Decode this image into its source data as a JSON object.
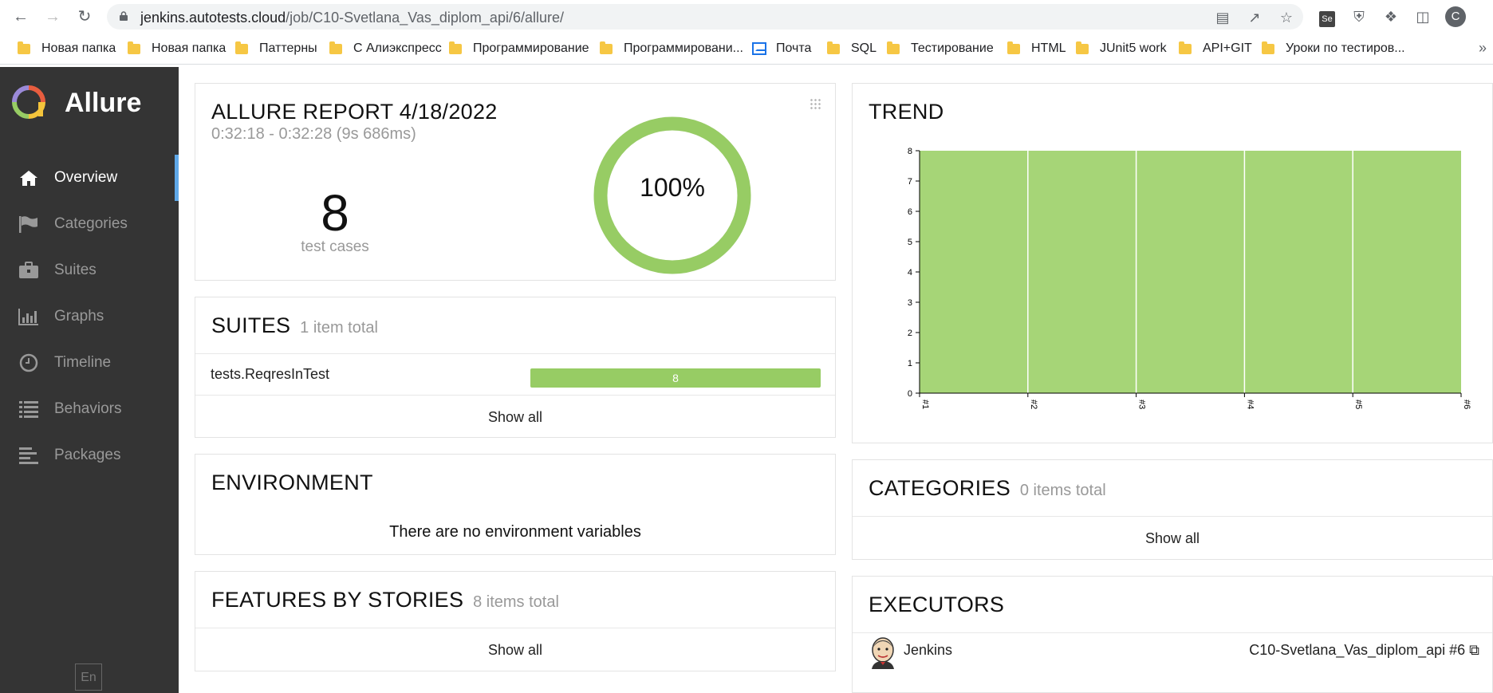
{
  "browser": {
    "url_host": "jenkins.autotests.cloud",
    "url_path": "/job/C10-Svetlana_Vas_diplom_api/6/allure/",
    "profile_initial": "C",
    "bookmarks": [
      {
        "label": "Новая папка",
        "icon": "folder-icon"
      },
      {
        "label": "Новая папка",
        "icon": "folder-icon"
      },
      {
        "label": "Паттерны",
        "icon": "folder-icon"
      },
      {
        "label": "С Алиэкспресс",
        "icon": "folder-icon"
      },
      {
        "label": "Программирование",
        "icon": "folder-icon"
      },
      {
        "label": "Программировани...",
        "icon": "folder-icon"
      },
      {
        "label": "Почта",
        "icon": "mail-icon"
      },
      {
        "label": "SQL",
        "icon": "folder-icon"
      },
      {
        "label": "Тестирование",
        "icon": "folder-icon"
      },
      {
        "label": "HTML",
        "icon": "folder-icon"
      },
      {
        "label": "JUnit5 work",
        "icon": "folder-icon"
      },
      {
        "label": "API+GIT",
        "icon": "folder-icon"
      },
      {
        "label": "Уроки по тестиров...",
        "icon": "folder-icon"
      }
    ],
    "more": "»"
  },
  "sidebar": {
    "brand": "Allure",
    "items": [
      {
        "label": "Overview",
        "icon": "home-icon",
        "active": true
      },
      {
        "label": "Categories",
        "icon": "flag-icon",
        "active": false
      },
      {
        "label": "Suites",
        "icon": "briefcase-icon",
        "active": false
      },
      {
        "label": "Graphs",
        "icon": "bar-chart-icon",
        "active": false
      },
      {
        "label": "Timeline",
        "icon": "clock-icon",
        "active": false
      },
      {
        "label": "Behaviors",
        "icon": "list-icon",
        "active": false
      },
      {
        "label": "Packages",
        "icon": "align-left-icon",
        "active": false
      }
    ],
    "language": "En"
  },
  "summary": {
    "title": "ALLURE REPORT 4/18/2022",
    "time_range": "0:32:18 - 0:32:28 (9s 686ms)",
    "test_count": "8",
    "test_label": "test cases",
    "success_rate": "100%",
    "passed_fraction": 1.0,
    "colors": {
      "passed": "#97cc64"
    }
  },
  "suites": {
    "title": "SUITES",
    "count_text": "1 item total",
    "rows": [
      {
        "name": "tests.ReqresInTest",
        "passed": "8"
      }
    ],
    "show_all": "Show all"
  },
  "environment": {
    "title": "ENVIRONMENT",
    "empty_text": "There are no environment variables"
  },
  "features": {
    "title": "FEATURES BY STORIES",
    "count_text": "8 items total",
    "show_all": "Show all"
  },
  "trend": {
    "title": "TREND"
  },
  "categories": {
    "title": "CATEGORIES",
    "count_text": "0 items total",
    "show_all": "Show all"
  },
  "executors": {
    "title": "EXECUTORS",
    "name": "Jenkins",
    "build": "C10-Svetlana_Vas_diplom_api #6"
  },
  "chart_data": {
    "type": "area",
    "x": [
      "#1",
      "#2",
      "#3",
      "#4",
      "#5",
      "#6"
    ],
    "series": [
      {
        "values": [
          8,
          8,
          8,
          8,
          8,
          8
        ],
        "color": "#a6d577"
      }
    ],
    "ylim": [
      0,
      8
    ],
    "yticks": [
      "0",
      "1",
      "2",
      "3",
      "4",
      "5",
      "6",
      "7",
      "8"
    ],
    "grid": false
  }
}
